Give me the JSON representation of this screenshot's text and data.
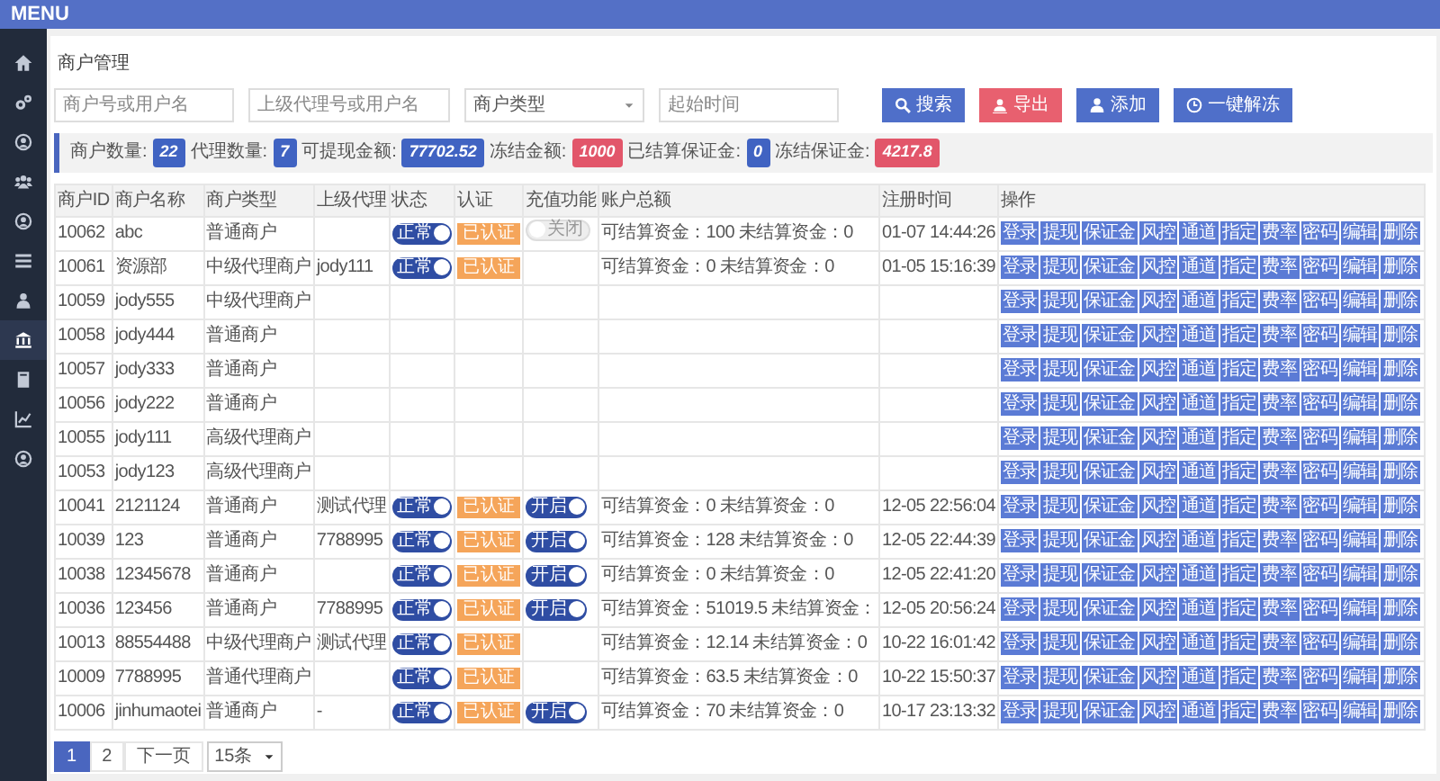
{
  "header": {
    "title": "MENU"
  },
  "sidebar": {
    "items": [
      {
        "selected": false
      },
      {
        "selected": false
      },
      {
        "selected": false
      },
      {
        "selected": false
      },
      {
        "selected": false
      },
      {
        "selected": false
      },
      {
        "selected": false
      },
      {
        "selected": true
      },
      {
        "selected": false
      },
      {
        "selected": false
      },
      {
        "selected": false
      }
    ]
  },
  "page_title": "商户管理",
  "filters": {
    "fields": [
      {
        "kind": "input",
        "placeholder": "商户号或用户名"
      },
      {
        "kind": "input",
        "placeholder": "上级代理号或用户名"
      },
      {
        "kind": "select",
        "value": "商户类型"
      },
      {
        "kind": "input",
        "placeholder": "起始时间"
      }
    ],
    "buttons": [
      {
        "label": "搜索",
        "kind": "search"
      },
      {
        "label": "导出",
        "kind": "export"
      },
      {
        "label": "添加",
        "kind": "add"
      },
      {
        "label": "一键解冻",
        "kind": "unfreeze"
      }
    ]
  },
  "stats": [
    {
      "label": "商户数量:",
      "value": "22",
      "color": "#4063c2"
    },
    {
      "label": "代理数量:",
      "value": "7",
      "color": "#4063c2"
    },
    {
      "label": "可提现金额:",
      "value": "77702.52",
      "color": "#4063c2"
    },
    {
      "label": "冻结金额:",
      "value": "1000",
      "color": "#e2566a"
    },
    {
      "label": "已结算保证金:",
      "value": "0",
      "color": "#4063c2"
    },
    {
      "label": "冻结保证金:",
      "value": "4217.8",
      "color": "#e2566a"
    }
  ],
  "table": {
    "columns": [
      "商户ID",
      "商户名称",
      "商户类型",
      "上级代理",
      "状态",
      "认证",
      "充值功能",
      "账户总额",
      "注册时间",
      "操作"
    ],
    "rows": [
      {
        "id": "10062",
        "name": "abc",
        "type": "普通商户",
        "status": {
          "label": "正常",
          "on": true
        },
        "verified": "已认证",
        "recharge": {
          "label": "关闭",
          "on": false
        },
        "balance": "可结算资金：100 未结算资金：0",
        "time": "01-07 14:44:26",
        "actions": [
          "登录",
          "提现",
          "保证金",
          "风控",
          "通道",
          "指定",
          "费率",
          "密码",
          "编辑",
          "删除"
        ]
      },
      {
        "id": "10061",
        "name": "资源部",
        "type": "中级代理商户",
        "agent": "jody111",
        "status": {
          "label": "正常",
          "on": true
        },
        "verified": "已认证",
        "balance": "可结算资金：0 未结算资金：0",
        "time": "01-05 15:16:39",
        "actions": [
          "登录",
          "提现",
          "保证金",
          "风控",
          "通道",
          "指定",
          "费率",
          "密码",
          "编辑",
          "删除"
        ]
      },
      {
        "id": "10059",
        "name": "jody555",
        "type": "中级代理商户",
        "actions": [
          "登录",
          "提现",
          "保证金",
          "风控",
          "通道",
          "指定",
          "费率",
          "密码",
          "编辑",
          "删除"
        ]
      },
      {
        "id": "10058",
        "name": "jody444",
        "type": "普通商户",
        "actions": [
          "登录",
          "提现",
          "保证金",
          "风控",
          "通道",
          "指定",
          "费率",
          "密码",
          "编辑",
          "删除"
        ]
      },
      {
        "id": "10057",
        "name": "jody333",
        "type": "普通商户",
        "actions": [
          "登录",
          "提现",
          "保证金",
          "风控",
          "通道",
          "指定",
          "费率",
          "密码",
          "编辑",
          "删除"
        ]
      },
      {
        "id": "10056",
        "name": "jody222",
        "type": "普通商户",
        "actions": [
          "登录",
          "提现",
          "保证金",
          "风控",
          "通道",
          "指定",
          "费率",
          "密码",
          "编辑",
          "删除"
        ]
      },
      {
        "id": "10055",
        "name": "jody111",
        "type": "高级代理商户",
        "actions": [
          "登录",
          "提现",
          "保证金",
          "风控",
          "通道",
          "指定",
          "费率",
          "密码",
          "编辑",
          "删除"
        ]
      },
      {
        "id": "10053",
        "name": "jody123",
        "type": "高级代理商户",
        "actions": [
          "登录",
          "提现",
          "保证金",
          "风控",
          "通道",
          "指定",
          "费率",
          "密码",
          "编辑",
          "删除"
        ]
      },
      {
        "id": "10041",
        "name": "2121124",
        "type": "普通商户",
        "agent": "测试代理",
        "status": {
          "label": "正常",
          "on": true
        },
        "verified": "已认证",
        "recharge": {
          "label": "开启",
          "on": true
        },
        "balance": "可结算资金：0 未结算资金：0",
        "time": "12-05 22:56:04",
        "actions": [
          "登录",
          "提现",
          "保证金",
          "风控",
          "通道",
          "指定",
          "费率",
          "密码",
          "编辑",
          "删除"
        ]
      },
      {
        "id": "10039",
        "name": "123",
        "type": "普通商户",
        "agent": "7788995",
        "status": {
          "label": "正常",
          "on": true
        },
        "verified": "已认证",
        "recharge": {
          "label": "开启",
          "on": true
        },
        "balance": "可结算资金：128 未结算资金：0",
        "time": "12-05 22:44:39",
        "actions": [
          "登录",
          "提现",
          "保证金",
          "风控",
          "通道",
          "指定",
          "费率",
          "密码",
          "编辑",
          "删除"
        ]
      },
      {
        "id": "10038",
        "name": "12345678",
        "type": "普通商户",
        "status": {
          "label": "正常",
          "on": true
        },
        "verified": "已认证",
        "recharge": {
          "label": "开启",
          "on": true
        },
        "balance": "可结算资金：0 未结算资金：0",
        "time": "12-05 22:41:20",
        "actions": [
          "登录",
          "提现",
          "保证金",
          "风控",
          "通道",
          "指定",
          "费率",
          "密码",
          "编辑",
          "删除"
        ]
      },
      {
        "id": "10036",
        "name": "123456",
        "type": "普通商户",
        "agent": "7788995",
        "status": {
          "label": "正常",
          "on": true
        },
        "verified": "已认证",
        "recharge": {
          "label": "开启",
          "on": true
        },
        "balance": "可结算资金：51019.5 未结算资金：",
        "time": "12-05 20:56:24",
        "actions": [
          "登录",
          "提现",
          "保证金",
          "风控",
          "通道",
          "指定",
          "费率",
          "密码",
          "编辑",
          "删除"
        ]
      },
      {
        "id": "10013",
        "name": "88554488",
        "type": "中级代理商户",
        "agent": "测试代理",
        "status": {
          "label": "正常",
          "on": true
        },
        "verified": "已认证",
        "balance": "可结算资金：12.14 未结算资金：0",
        "time": "10-22 16:01:42",
        "actions": [
          "登录",
          "提现",
          "保证金",
          "风控",
          "通道",
          "指定",
          "费率",
          "密码",
          "编辑",
          "删除"
        ]
      },
      {
        "id": "10009",
        "name": "7788995",
        "type": "普通代理商户",
        "status": {
          "label": "正常",
          "on": true
        },
        "verified": "已认证",
        "balance": "可结算资金：63.5 未结算资金：0",
        "time": "10-22 15:50:37",
        "actions": [
          "登录",
          "提现",
          "保证金",
          "风控",
          "通道",
          "指定",
          "费率",
          "密码",
          "编辑",
          "删除"
        ]
      },
      {
        "id": "10006",
        "name": "jinhumaotei",
        "type": "普通商户",
        "agent": "-",
        "status": {
          "label": "正常",
          "on": true
        },
        "verified": "已认证",
        "recharge": {
          "label": "开启",
          "on": true
        },
        "balance": "可结算资金：70 未结算资金：0",
        "time": "10-17 23:13:32",
        "actions": [
          "登录",
          "提现",
          "保证金",
          "风控",
          "通道",
          "指定",
          "费率",
          "密码",
          "编辑",
          "删除"
        ]
      }
    ]
  },
  "pagination": {
    "pages": [
      {
        "label": "1",
        "selected": true
      },
      {
        "label": "2",
        "selected": false
      }
    ],
    "next": "下一页",
    "page_size": "15条"
  }
}
